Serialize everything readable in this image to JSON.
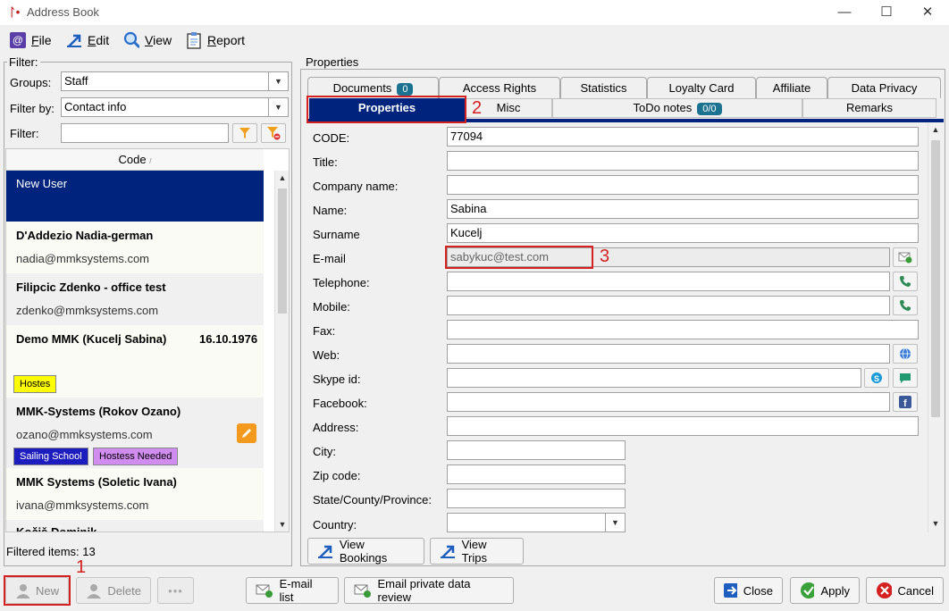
{
  "window": {
    "title": "Address Book",
    "controls": {
      "minimize": "—",
      "maximize": "☐",
      "close": "✕"
    }
  },
  "menu": {
    "file": "File",
    "edit": "Edit",
    "view": "View",
    "report": "Report"
  },
  "filter": {
    "legend": "Filter:",
    "groups_label": "Groups:",
    "groups_value": "Staff",
    "filterby_label": "Filter by:",
    "filterby_value": "Contact info",
    "filter_label": "Filter:",
    "filter_value": ""
  },
  "list": {
    "column_header": "Code",
    "sort_indicator": "/",
    "rows": [
      {
        "title": "New User",
        "sub": ""
      },
      {
        "title": "D'Addezio Nadia-german",
        "sub": "nadia@mmksystems.com"
      },
      {
        "title": "Filipcic Zdenko - office test",
        "sub": "zdenko@mmksystems.com"
      },
      {
        "title": "Demo MMK (Kucelj Sabina)",
        "date": "16.10.1976",
        "sub": "",
        "tags": [
          "Hostes"
        ]
      },
      {
        "title": "MMK-Systems (Rokov Ozano)",
        "sub": "ozano@mmksystems.com",
        "tags": [
          "Sailing School",
          "Hostess Needed"
        ]
      },
      {
        "title": "MMK Systems (Soletic Ivana)",
        "sub": "ivana@mmksystems.com"
      },
      {
        "title": "Kočiš Dominik",
        "sub": ""
      }
    ],
    "filtered_label": "Filtered items: 13"
  },
  "properties": {
    "legend": "Properties",
    "tabs_top": [
      {
        "label": "Documents",
        "badge": "0"
      },
      {
        "label": "Access Rights"
      },
      {
        "label": "Statistics"
      },
      {
        "label": "Loyalty Card"
      },
      {
        "label": "Affiliate"
      },
      {
        "label": "Data Privacy"
      }
    ],
    "tabs_bottom": [
      {
        "label": "Properties",
        "active": true
      },
      {
        "label": "Misc"
      },
      {
        "label": "ToDo notes",
        "badge": "0/0"
      },
      {
        "label": "Remarks"
      }
    ],
    "fields": [
      {
        "label": "CODE:",
        "value": "77094"
      },
      {
        "label": "Title:",
        "value": ""
      },
      {
        "label": "Company name:",
        "value": ""
      },
      {
        "label": "Name:",
        "value": "Sabina"
      },
      {
        "label": "Surname",
        "value": "Kucelj"
      },
      {
        "label": "E-mail",
        "value": "sabykuc@test.com"
      },
      {
        "label": "Telephone:",
        "value": ""
      },
      {
        "label": "Mobile:",
        "value": ""
      },
      {
        "label": "Fax:",
        "value": ""
      },
      {
        "label": "Web:",
        "value": ""
      },
      {
        "label": "Skype id:",
        "value": ""
      },
      {
        "label": "Facebook:",
        "value": ""
      },
      {
        "label": "Address:",
        "value": ""
      },
      {
        "label": "City:",
        "value": ""
      },
      {
        "label": "Zip code:",
        "value": ""
      },
      {
        "label": "State/County/Province:",
        "value": ""
      },
      {
        "label": "Country:",
        "value": ""
      }
    ],
    "view_bookings": "View Bookings",
    "view_trips": "View Trips"
  },
  "bottom": {
    "new": "New",
    "delete": "Delete",
    "more": "•••",
    "email_list": "E-mail list",
    "email_private": "Email private data review",
    "close": "Close",
    "apply": "Apply",
    "cancel": "Cancel"
  },
  "annotations": {
    "n1": "1",
    "n2": "2",
    "n3": "3"
  },
  "colors": {
    "selected_row": "#00247d",
    "tab_active": "#00247d",
    "tag_yellow": "#ffff00",
    "tag_blue": "#1d1dbf",
    "tag_violet": "#d18cf0",
    "badge": "#1c7391",
    "annotation_red": "#d42020"
  }
}
